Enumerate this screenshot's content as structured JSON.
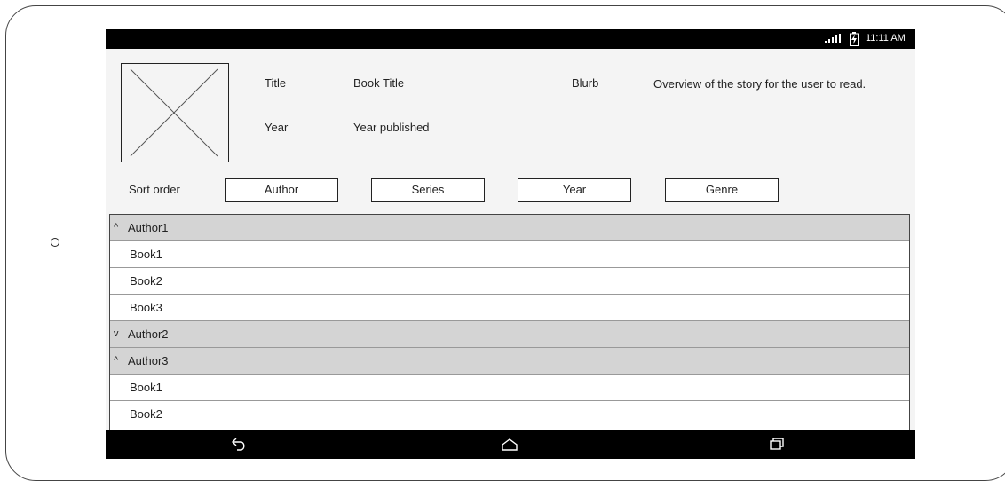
{
  "status_bar": {
    "time": "11:11 AM",
    "signal": "signal-icon",
    "battery": "battery-charging-icon"
  },
  "header": {
    "image_placeholder": "image-placeholder-icon",
    "title_label": "Title",
    "title_value": "Book Title",
    "year_label": "Year",
    "year_value": "Year published",
    "blurb_label": "Blurb",
    "blurb_value": "Overview of the story for the user to read."
  },
  "sort": {
    "label": "Sort order",
    "buttons": [
      "Author",
      "Series",
      "Year",
      "Genre"
    ]
  },
  "list": [
    {
      "type": "group",
      "chevron": "^",
      "label": "Author1"
    },
    {
      "type": "book",
      "label": "Book1"
    },
    {
      "type": "book",
      "label": "Book2"
    },
    {
      "type": "book",
      "label": "Book3"
    },
    {
      "type": "group",
      "chevron": "v",
      "label": "Author2"
    },
    {
      "type": "group",
      "chevron": "^",
      "label": "Author3"
    },
    {
      "type": "book",
      "label": "Book1"
    },
    {
      "type": "book",
      "label": "Book2"
    }
  ],
  "nav_bar": {
    "back": "back-icon",
    "home": "home-icon",
    "recents": "recents-icon"
  }
}
